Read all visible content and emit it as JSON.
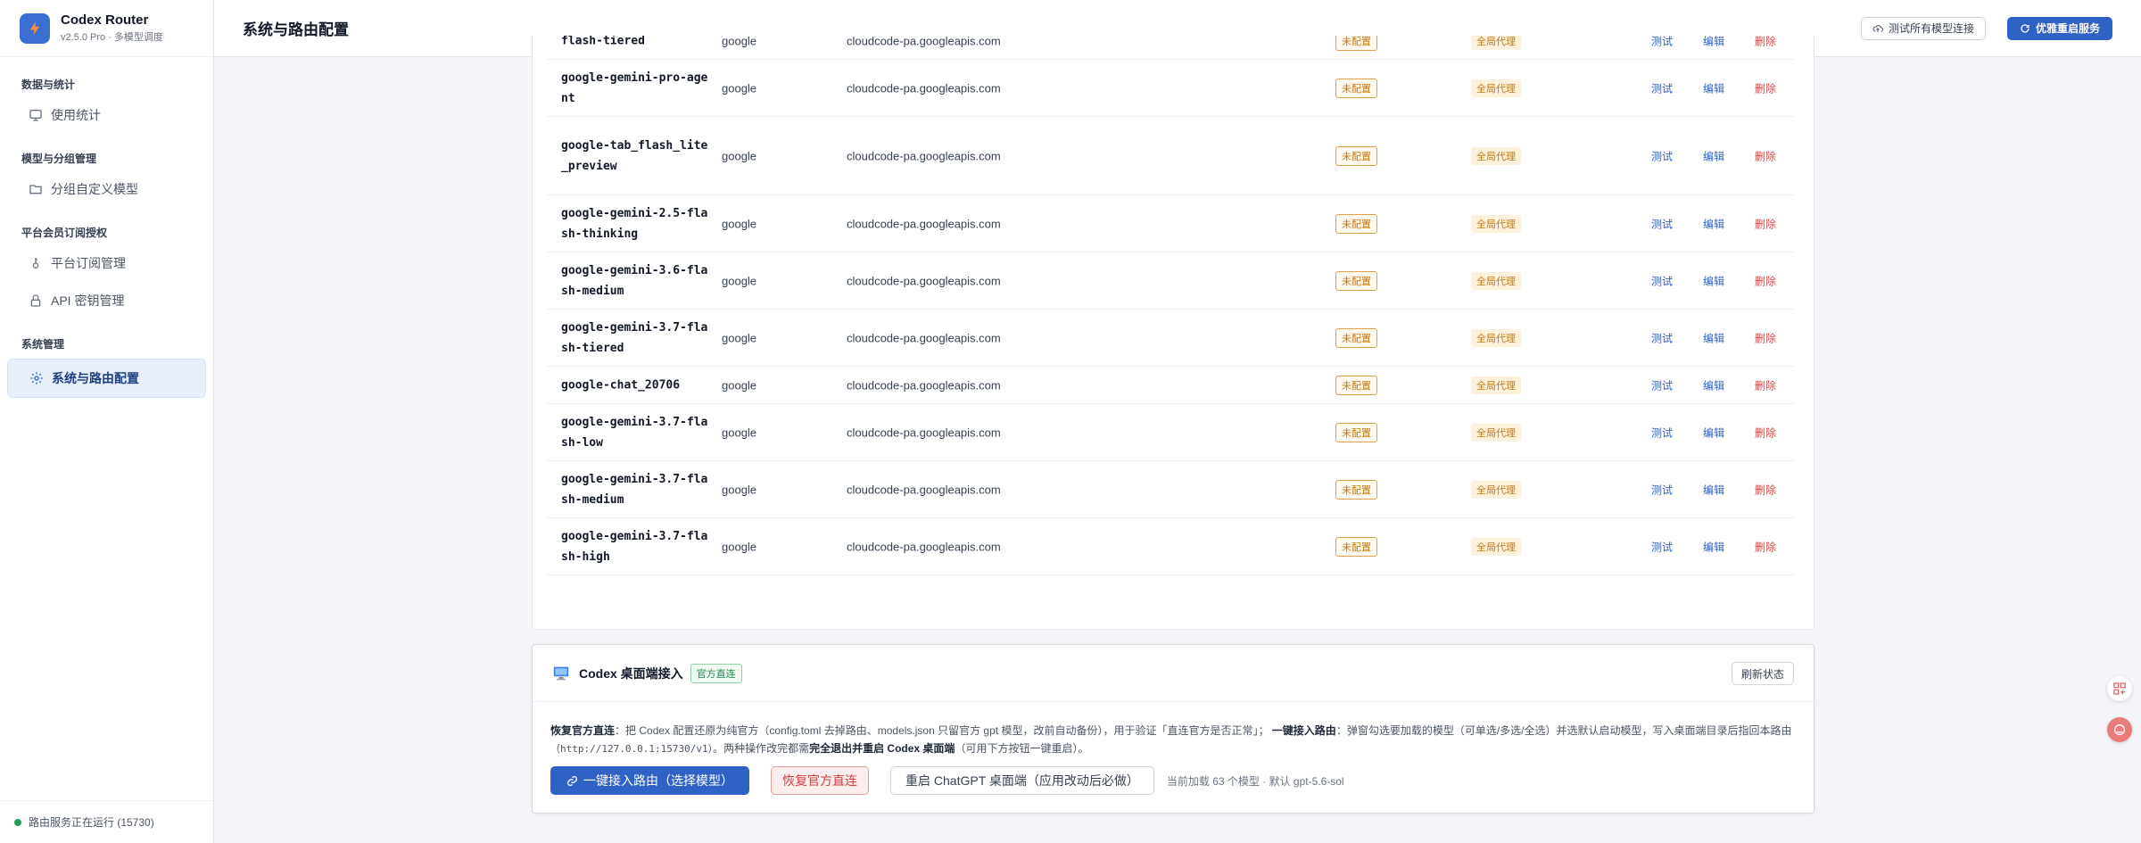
{
  "sidebar": {
    "brand_name": "Codex Router",
    "brand_version": "v2.5.0 Pro · 多模型调度",
    "sections": [
      {
        "title": "数据与统计",
        "items": [
          {
            "label": "使用统计",
            "icon": "chart-icon"
          }
        ]
      },
      {
        "title": "模型与分组管理",
        "items": [
          {
            "label": "分组自定义模型",
            "icon": "folder-icon"
          }
        ]
      },
      {
        "title": "平台会员订阅授权",
        "items": [
          {
            "label": "平台订阅管理",
            "icon": "key-icon"
          },
          {
            "label": "API 密钥管理",
            "icon": "lock-icon"
          }
        ]
      },
      {
        "title": "系统管理",
        "items": [
          {
            "label": "系统与路由配置",
            "icon": "gear-icon",
            "active": true
          }
        ]
      }
    ],
    "footer_status": "路由服务正在运行 (15730)"
  },
  "topbar": {
    "title": "系统与路由配置",
    "test_all_label": "测试所有模型连接",
    "restart_label": "优雅重启服务"
  },
  "table": {
    "rows": [
      {
        "name": "flash-tiered",
        "provider": "google",
        "url": "cloudcode-pa.googleapis.com",
        "status": "未配置",
        "mode": "全局代理"
      },
      {
        "name": "google-gemini-pro-agent",
        "provider": "google",
        "url": "cloudcode-pa.googleapis.com",
        "status": "未配置",
        "mode": "全局代理"
      },
      {
        "name": "google-tab_flash_lite_preview",
        "provider": "google",
        "url": "cloudcode-pa.googleapis.com",
        "status": "未配置",
        "mode": "全局代理"
      },
      {
        "name": "google-gemini-2.5-flash-thinking",
        "provider": "google",
        "url": "cloudcode-pa.googleapis.com",
        "status": "未配置",
        "mode": "全局代理"
      },
      {
        "name": "google-gemini-3.6-flash-medium",
        "provider": "google",
        "url": "cloudcode-pa.googleapis.com",
        "status": "未配置",
        "mode": "全局代理"
      },
      {
        "name": "google-gemini-3.7-flash-tiered",
        "provider": "google",
        "url": "cloudcode-pa.googleapis.com",
        "status": "未配置",
        "mode": "全局代理"
      },
      {
        "name": "google-chat_20706",
        "provider": "google",
        "url": "cloudcode-pa.googleapis.com",
        "status": "未配置",
        "mode": "全局代理"
      },
      {
        "name": "google-gemini-3.7-flash-low",
        "provider": "google",
        "url": "cloudcode-pa.googleapis.com",
        "status": "未配置",
        "mode": "全局代理"
      },
      {
        "name": "google-gemini-3.7-flash-medium",
        "provider": "google",
        "url": "cloudcode-pa.googleapis.com",
        "status": "未配置",
        "mode": "全局代理"
      },
      {
        "name": "google-gemini-3.7-flash-high",
        "provider": "google",
        "url": "cloudcode-pa.googleapis.com",
        "status": "未配置",
        "mode": "全局代理"
      }
    ],
    "action_test": "测试",
    "action_edit": "编辑",
    "action_delete": "删除"
  },
  "codex": {
    "title": "Codex 桌面端接入",
    "tag": "官方直连",
    "refresh_label": "刷新状态",
    "desc_b1": "恢复官方直连",
    "desc_t1": "：把 Codex 配置还原为纯官方（config.toml 去掉路由、models.json 只留官方 gpt 模型，改前自动备份），用于验证「直连官方是否正常」；",
    "desc_b2": "一键接入路由",
    "desc_t2": "：弹窗勾选要加载的模型（可单选/多选/全选）并选默认启动模型，写入桌面端目录后指回本路由",
    "desc_url": "（http://127.0.0.1:15730/v1）",
    "desc_t3": "。两种操作改完都需",
    "desc_b3": "完全退出并重启 Codex 桌面端",
    "desc_t4": "（可用下方按钮一键重启）。",
    "btn_route": "一键接入路由（选择模型）",
    "btn_restore": "恢复官方直连",
    "btn_restart": "重启 ChatGPT 桌面端（应用改动后必做）",
    "hint": "当前加载 63 个模型 · 默认 gpt-5.6-sol"
  },
  "colors": {
    "accent": "#2f62c5",
    "warning": "#c27a12",
    "danger": "#d23d3d",
    "success": "#1f8a4c"
  }
}
